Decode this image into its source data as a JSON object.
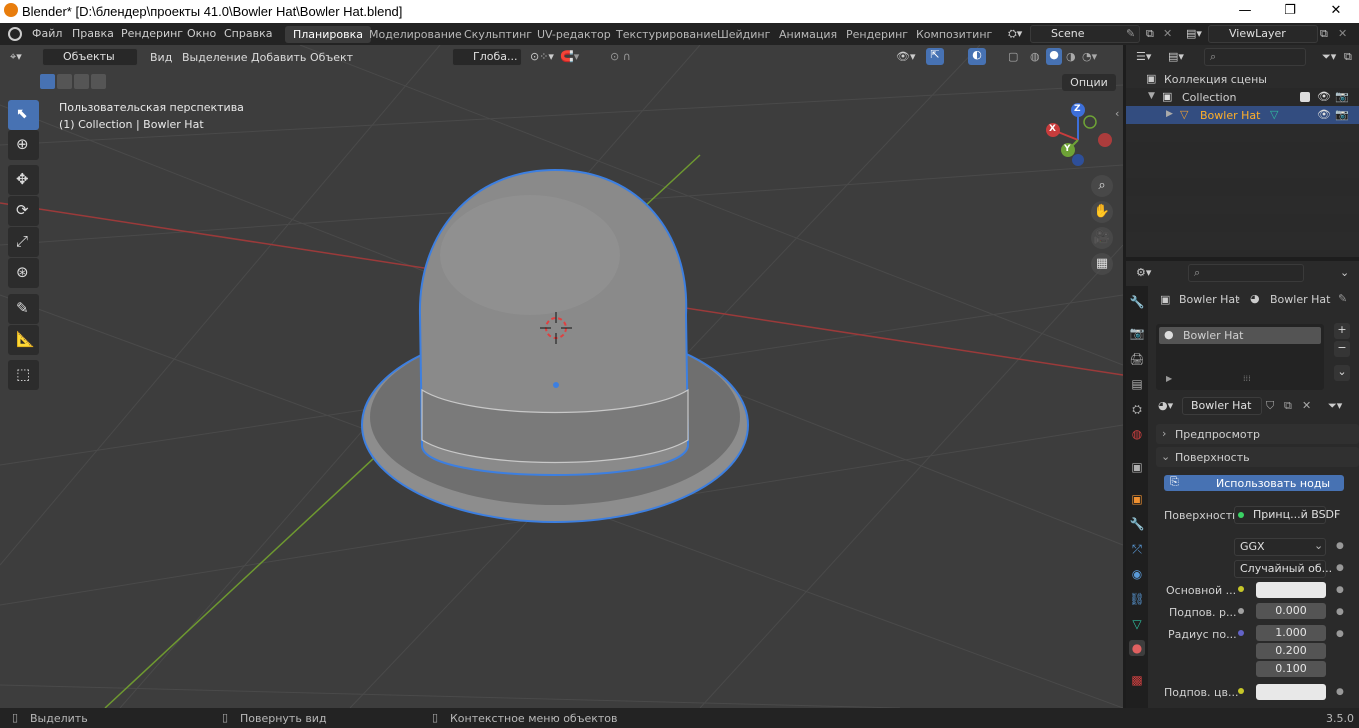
{
  "window": {
    "title": "Blender* [D:\\блендер\\проекты 41.0\\Bowler Hat\\Bowler Hat.blend]",
    "minimize": "—",
    "maximize": "❐",
    "close": "✕"
  },
  "menus": [
    "Файл",
    "Правка",
    "Рендеринг",
    "Окно",
    "Справка"
  ],
  "workspaces": [
    "Планировка",
    "Моделирование",
    "Скульптинг",
    "UV-редактор",
    "Текстурирование",
    "Шейдинг",
    "Анимация",
    "Рендеринг",
    "Композитинг"
  ],
  "scene": "Scene",
  "view_layer": "ViewLayer",
  "viewport_header": {
    "mode": "Объекты",
    "items": [
      "Вид",
      "Выделение",
      "Добавить",
      "Объект"
    ],
    "orientation": "Глоба...",
    "options": "Опции"
  },
  "viewport_info": {
    "line1": "Пользовательская перспектива",
    "line2": "(1) Collection | Bowler Hat"
  },
  "gizmo": {
    "x": "X",
    "y": "Y",
    "z": "Z"
  },
  "outliner": {
    "root": "Коллекция сцены",
    "collection": "Collection",
    "object": "Bowler Hat"
  },
  "properties": {
    "breadcrumb_object": "Bowler Hat",
    "breadcrumb_material": "Bowler Hat",
    "slot": "Bowler Hat",
    "material_name": "Bowler Hat",
    "sections": {
      "preview": "Предпросмотр",
      "surface": "Поверхность"
    },
    "use_nodes": "Использовать ноды",
    "surface_label": "Поверхность",
    "surface_shader": "Принц...й BSDF",
    "distribution": "GGX",
    "subsurface_method": "Случайный об...",
    "rows": [
      {
        "label": "Основной ...",
        "value": ""
      },
      {
        "label": "Подпов. р...",
        "value": "0.000"
      },
      {
        "label": "Радиус по...",
        "value": "1.000"
      },
      {
        "label": "",
        "value": "0.200"
      },
      {
        "label": "",
        "value": "0.100"
      },
      {
        "label": "Подпов. цв...",
        "value": ""
      }
    ]
  },
  "statusbar": {
    "select": "Выделить",
    "rotate": "Повернуть вид",
    "context": "Контекстное меню объектов",
    "version": "3.5.0"
  },
  "colors": {
    "accent": "#4772b3",
    "selection_outline": "#3d7fe0",
    "x_axis": "#9b3a3a",
    "y_axis": "#6e9930",
    "viewport_bg": "#3d3d3d"
  }
}
